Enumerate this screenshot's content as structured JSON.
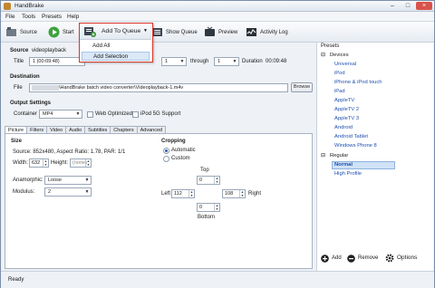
{
  "window": {
    "title": "HandBrake",
    "min": "–",
    "max": "□",
    "close": "×"
  },
  "menu": [
    "File",
    "Tools",
    "Presets",
    "Help"
  ],
  "toolbar": {
    "source": "Source",
    "start": "Start",
    "add_to_queue": "Add To Queue",
    "show_queue": "Show Queue",
    "preview": "Preview",
    "activity_log": "Activity Log"
  },
  "queue_menu": {
    "add_all": "Add All",
    "add_selection": "Add Selection"
  },
  "source": {
    "heading": "Source",
    "name": "videoplayback",
    "title_label": "Title",
    "title_value": "1 (00:09:48)",
    "range_value": "1",
    "through_label": "through",
    "through_value": "1",
    "duration_label": "Duration",
    "duration_value": "00:09:48"
  },
  "destination": {
    "heading": "Destination",
    "file_label": "File",
    "file_value": "\\HandBrake batch video converter\\Videoplayback-1.m4v",
    "browse": "Browse"
  },
  "output": {
    "heading": "Output Settings",
    "container_label": "Container",
    "container_value": "MP4",
    "web_optimized": "Web Optimized",
    "ipod": "iPod 5G Support"
  },
  "tabs": [
    "Picture",
    "Filters",
    "Video",
    "Audio",
    "Subtitles",
    "Chapters",
    "Advanced"
  ],
  "picture": {
    "size_heading": "Size",
    "source_info": "Source:  852x480, Aspect Ratio: 1.78, PAR: 1/1",
    "width_label": "Width:",
    "width_value": "632",
    "height_label": "Height:",
    "height_value": "(none)",
    "anamorphic_label": "Anamorphic:",
    "anamorphic_value": "Loose",
    "modulus_label": "Modulus:",
    "modulus_value": "2",
    "cropping_heading": "Cropping",
    "automatic": "Automatic",
    "custom": "Custom",
    "top_label": "Top",
    "top_value": "0",
    "left_label": "Left",
    "left_value": "112",
    "right_label": "Right",
    "right_value": "108",
    "bottom_label": "Bottom",
    "bottom_value": "0"
  },
  "presets": {
    "heading": "Presets",
    "devices_label": "Devices",
    "devices": [
      "Universal",
      "iPod",
      "iPhone & iPod touch",
      "iPad",
      "AppleTV",
      "AppleTV 2",
      "AppleTV 3",
      "Android",
      "Android Tablet",
      "Windows Phone 8"
    ],
    "regular_label": "Regular",
    "regular": [
      "Normal",
      "High Profile"
    ],
    "add": "Add",
    "remove": "Remove",
    "options": "Options"
  },
  "status": "Ready"
}
